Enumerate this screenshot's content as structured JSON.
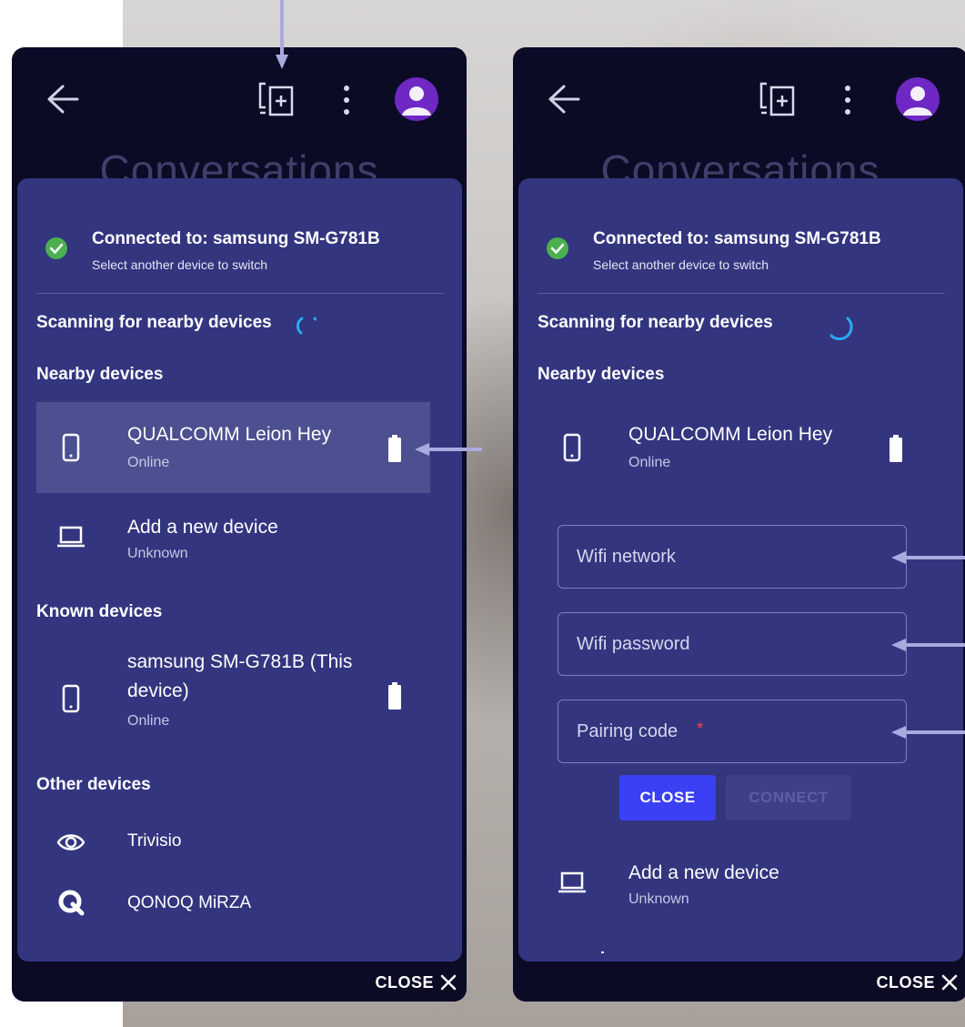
{
  "colors": {
    "phone_bg": "#0b0b26",
    "panel_bg": "#33357f",
    "highlight_bg": "#4c4f90",
    "accent_button": "#3b40f5",
    "success_green": "#4caf50",
    "avatar_purple": "#6f28c4",
    "spinner_blue": "#2aa9f0",
    "annotation_arrow": "#a9aadf"
  },
  "left": {
    "appbar": {
      "back_icon": "arrow-left-icon",
      "device_icon": "device-add-icon",
      "menu_icon": "more-vert-icon",
      "avatar_icon": "account-circle-icon",
      "background_title": "Conversations"
    },
    "connection": {
      "title": "Connected to:  samsung SM-G781B",
      "subtitle": "Select another device to switch"
    },
    "scanning_label": "Scanning for nearby devices",
    "nearby_header": "Nearby devices",
    "nearby": [
      {
        "name": "QUALCOMM Leion Hey",
        "status": "Online",
        "icon": "smartphone-icon",
        "battery": true,
        "selected": true
      },
      {
        "name": "Add a new device",
        "status": "Unknown",
        "icon": "laptop-icon",
        "battery": false
      }
    ],
    "known_header": "Known devices",
    "known": [
      {
        "name_line1": "samsung SM-G781B (This",
        "name_line2": "device)",
        "status": "Online",
        "icon": "smartphone-icon",
        "battery": true
      }
    ],
    "other_header": "Other devices",
    "other": [
      {
        "name": "Trivisio",
        "icon": "eye-icon"
      },
      {
        "name": "QONOQ MiRZA",
        "icon": "q-logo-icon"
      }
    ],
    "footer_close": "CLOSE"
  },
  "right": {
    "appbar": {
      "background_title": "Conversations"
    },
    "connection": {
      "title": "Connected to:  samsung SM-G781B",
      "subtitle": "Select another device to switch"
    },
    "scanning_label": "Scanning for nearby devices",
    "nearby_header": "Nearby devices",
    "device": {
      "name": "QUALCOMM Leion Hey",
      "status": "Online"
    },
    "form": {
      "wifi_network_placeholder": "Wifi network",
      "wifi_password_placeholder": "Wifi password",
      "pairing_code_placeholder": "Pairing code",
      "required_mark": "*",
      "close_button": "CLOSE",
      "connect_button": "CONNECT"
    },
    "add_device": {
      "name": "Add a new device",
      "status": "Unknown"
    },
    "footer_close": "CLOSE"
  }
}
